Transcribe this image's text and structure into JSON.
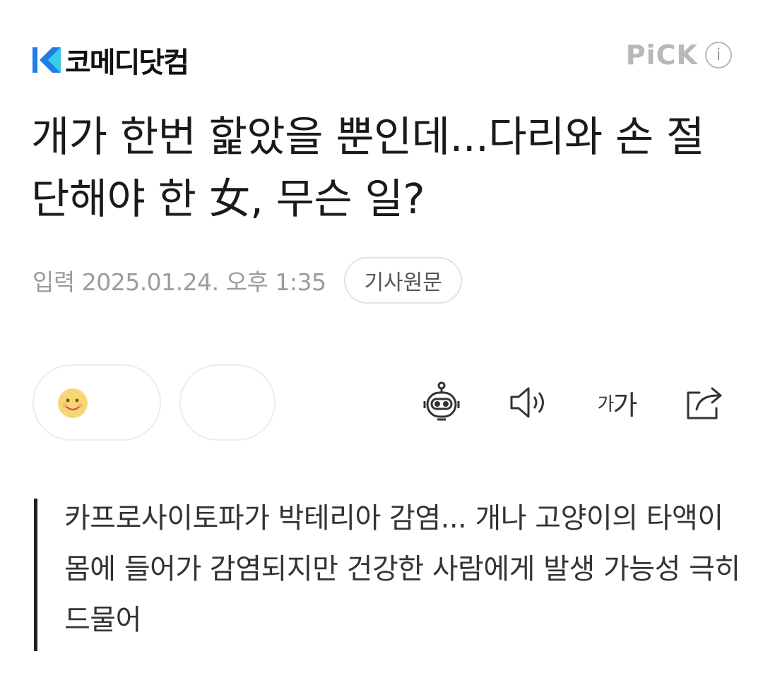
{
  "header": {
    "logo_text": "코메디닷컴",
    "logo_icon": "komedi-logo-icon",
    "pick_label": "PiCK",
    "info_icon_glyph": "i",
    "brand_color": "#1e7ee6"
  },
  "article": {
    "headline": "개가 한번 핥았을 뿐인데...다리와 손 절단해야 한 女, 무슨 일?",
    "date_label": "입력 2025.01.24. 오후 1:35",
    "source_button": "기사원문",
    "summary": "카프로사이토파가 박테리아 감염... 개나 고양이의 타액이 몸에 들어가 감염되지만 건강한 사람에게 발생 가능성 극히 드물어"
  },
  "reactions": {
    "emoji_icon": "smile-emoji-icon"
  },
  "toolbar": {
    "items": [
      {
        "icon": "robot-summary-icon"
      },
      {
        "icon": "speaker-icon"
      },
      {
        "icon": "font-size-icon",
        "small": "가",
        "large": "가"
      },
      {
        "icon": "share-icon"
      }
    ]
  }
}
